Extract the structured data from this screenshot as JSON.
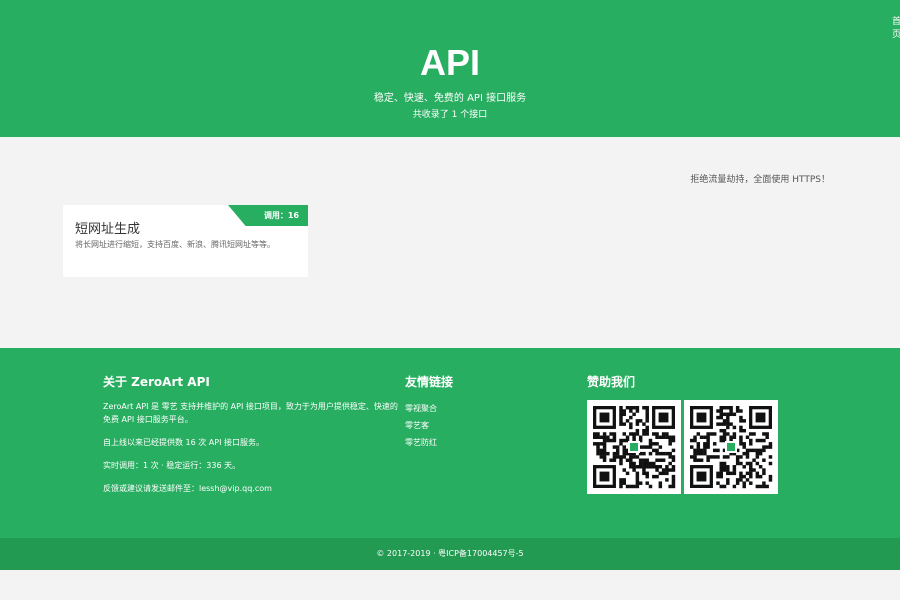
{
  "header": {
    "corner_link": "首页",
    "title": "API",
    "subtitle": "稳定、快速、免费的 API 接口服务",
    "count_text": "共收录了 1 个接口"
  },
  "notice": "拒绝流量劫持，全面使用 HTTPS！",
  "cards": [
    {
      "badge": "调用：16",
      "title": "短网址生成",
      "description": "将长网址进行缩短，支持百度、新浪、腾讯短网址等等。"
    }
  ],
  "footer": {
    "about": {
      "title": "关于 ZeroArt API",
      "p1": "ZeroArt API 是 零艺 支持并维护的 API 接口项目，致力于为用户提供稳定、快速的免费 API 接口服务平台。",
      "p2": "自上线以来已经提供数 16 次 API 接口服务。",
      "p3": "实时调用：1 次 · 稳定运行：336 天。",
      "p4": "反馈或建议请发送邮件至：lessh@vip.qq.com"
    },
    "links": {
      "title": "友情链接",
      "items": [
        "零视聚合",
        "零艺客",
        "零艺防红"
      ]
    },
    "donate": {
      "title": "赞助我们",
      "qr_codes": [
        "qr-code-icon",
        "qr-code-icon"
      ]
    },
    "copyright": "© 2017-2019 · 粤ICP备17004457号-5"
  },
  "colors": {
    "brand": "#27ae60",
    "copyright_bg": "#229a52",
    "page_bg": "#f3f3f3"
  }
}
